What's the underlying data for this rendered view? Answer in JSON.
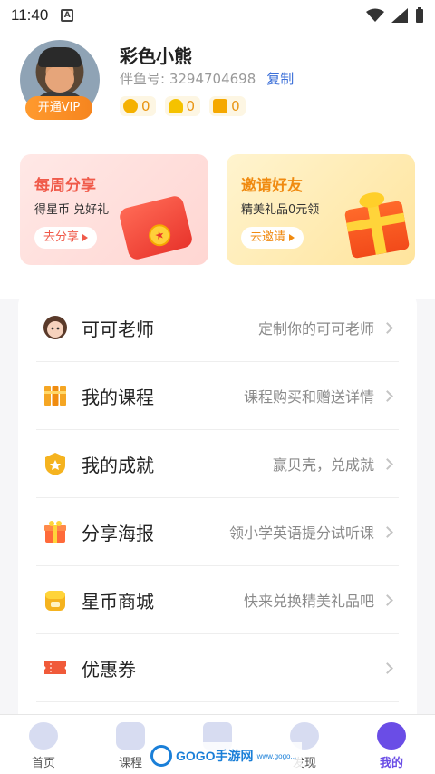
{
  "status_bar": {
    "time": "11:40",
    "notification_letter": "A"
  },
  "profile": {
    "nickname": "彩色小熊",
    "id_label": "伴鱼号: 3294704698",
    "copy_label": "复制",
    "vip_button": "开通VIP",
    "stats": [
      {
        "icon": "star-coin-icon",
        "value": "0",
        "color": "#f5b100"
      },
      {
        "icon": "cloud-icon",
        "value": "0",
        "color": "#f5c200"
      },
      {
        "icon": "thumbs-up-icon",
        "value": "0",
        "color": "#f5a800"
      }
    ]
  },
  "promo_cards": {
    "share": {
      "title": "每周分享",
      "subtitle": "得星币 兑好礼",
      "button": "去分享"
    },
    "invite": {
      "title": "邀请好友",
      "subtitle": "精美礼品0元领",
      "button": "去邀请"
    }
  },
  "menu": [
    {
      "icon": "teacher-avatar-icon",
      "label": "可可老师",
      "desc": "定制你的可可老师"
    },
    {
      "icon": "books-icon",
      "label": "我的课程",
      "desc": "课程购买和赠送详情"
    },
    {
      "icon": "badge-icon",
      "label": "我的成就",
      "desc": "赢贝壳，兑成就"
    },
    {
      "icon": "gift-icon",
      "label": "分享海报",
      "desc": "领小学英语提分试听课"
    },
    {
      "icon": "store-icon",
      "label": "星币商城",
      "desc": "快来兑换精美礼品吧"
    },
    {
      "icon": "ticket-icon",
      "label": "优惠券",
      "desc": ""
    }
  ],
  "tabbar": [
    {
      "label": "首页",
      "icon": "home-icon",
      "active": false
    },
    {
      "label": "课程",
      "icon": "course-icon",
      "active": false
    },
    {
      "label": "",
      "icon": "stats-icon",
      "active": false
    },
    {
      "label": "发现",
      "icon": "discover-icon",
      "active": false
    },
    {
      "label": "我的",
      "icon": "profile-icon",
      "active": true
    }
  ],
  "watermark": {
    "text": "GOGO手游网",
    "sub": "www.gogo..."
  },
  "colors": {
    "accent": "#6a4de6",
    "vip": "#f6851f",
    "link": "#3b6fd8"
  }
}
